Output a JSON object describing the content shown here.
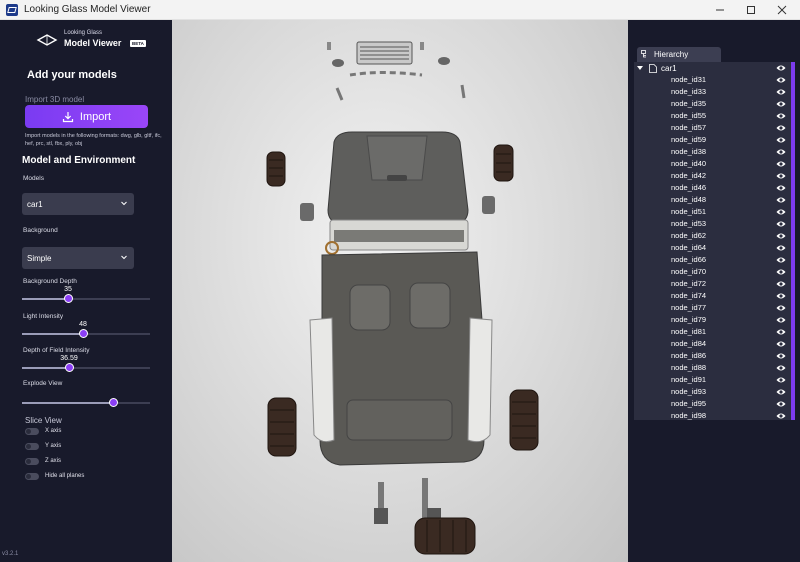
{
  "window": {
    "title": "Looking Glass Model Viewer",
    "minimize_icon": "minimize-icon",
    "maximize_icon": "maximize-icon",
    "close_icon": "close-icon"
  },
  "logo": {
    "line1": "Looking Glass",
    "line2": "Model Viewer",
    "badge": "BETA"
  },
  "sidebar": {
    "add_heading": "Add your models",
    "import_label": "Import 3D model",
    "import_button": "Import",
    "formats_text": "Import models in the following formats: dwg, glb, gltf, ifc, hef, prc, stl, fbx, ply, obj",
    "model_env_heading": "Model and Environment",
    "models_label": "Models",
    "models_value": "car1",
    "background_label": "Background",
    "background_value": "Simple",
    "bg_depth_label": "Background Depth",
    "bg_depth_value": "35",
    "bg_depth_fraction": 0.36,
    "light_label": "Light Intensity",
    "light_value": "48",
    "light_fraction": 0.48,
    "dof_label": "Depth of Field Intensity",
    "dof_value": "36.59",
    "dof_fraction": 0.37,
    "explode_label": "Explode View",
    "explode_fraction": 0.71,
    "slice_heading": "Slice View",
    "toggles": [
      "X axis",
      "Y axis",
      "Z axis",
      "Hide all planes"
    ],
    "version": "v3.2.1"
  },
  "hierarchy": {
    "tab_label": "Hierarchy",
    "root": "car1",
    "nodes": [
      "node_id31",
      "node_id33",
      "node_id35",
      "node_id55",
      "node_id57",
      "node_id59",
      "node_id38",
      "node_id40",
      "node_id42",
      "node_id46",
      "node_id48",
      "node_id51",
      "node_id53",
      "node_id62",
      "node_id64",
      "node_id66",
      "node_id70",
      "node_id72",
      "node_id74",
      "node_id77",
      "node_id79",
      "node_id81",
      "node_id84",
      "node_id86",
      "node_id88",
      "node_id91",
      "node_id93",
      "node_id95",
      "node_id98"
    ]
  },
  "colors": {
    "panel_bg": "#181a2b",
    "accent": "#8b3ff5",
    "tree_bg": "#2b2d3f"
  }
}
